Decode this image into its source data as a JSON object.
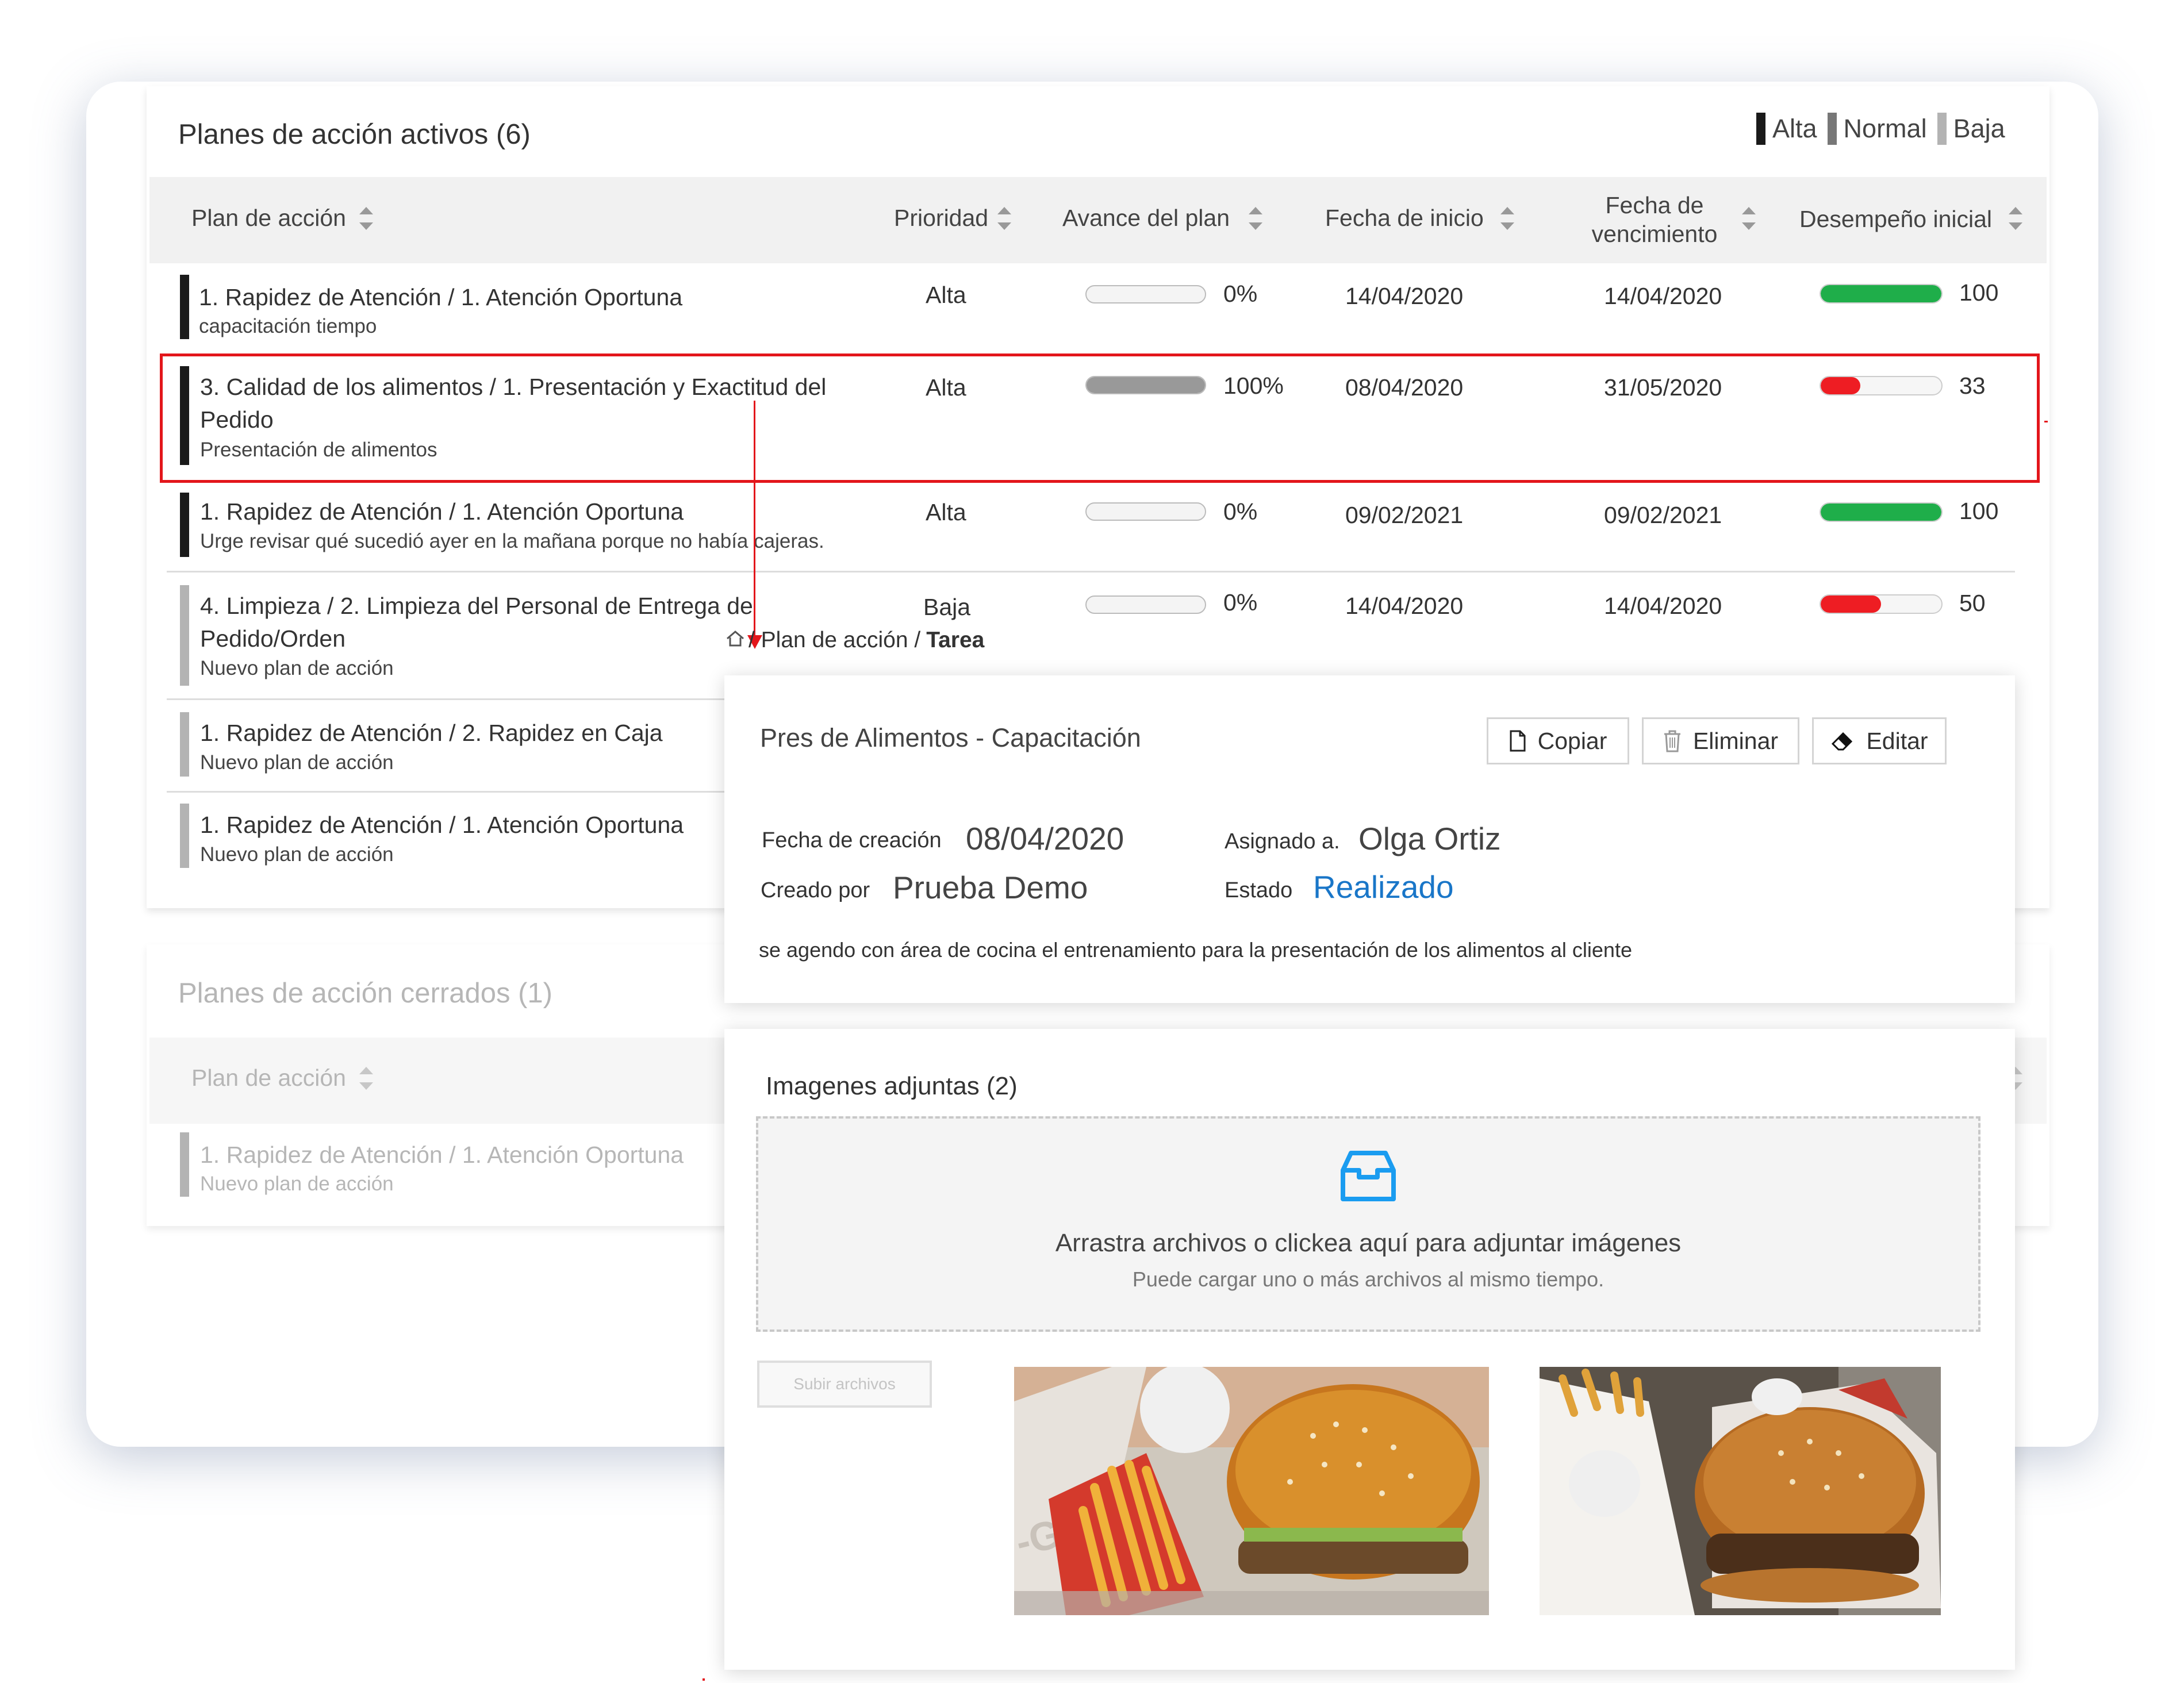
{
  "legend": [
    {
      "label": "Alta",
      "color": "#1a1a1a"
    },
    {
      "label": "Normal",
      "color": "#777777"
    },
    {
      "label": "Baja",
      "color": "#b3b3b3"
    }
  ],
  "active": {
    "title": "Planes de acción activos (6)",
    "columns": {
      "plan": "Plan de acción",
      "prioridad": "Prioridad",
      "avance": "Avance del plan",
      "inicio": "Fecha de inicio",
      "venc_1": "Fecha de",
      "venc_2": "vencimiento",
      "desempeno": "Desempeño inicial"
    },
    "rows": [
      {
        "title_1": "1. Rapidez de Atención / 1. Atención Oportuna",
        "title_2": "",
        "subtitle": "capacitación tiempo",
        "priority": "Alta",
        "progress": 0,
        "progress_label": "0%",
        "start": "14/04/2020",
        "due": "14/04/2020",
        "performance": 100,
        "performance_label": "100",
        "perf_color": "#1fae4a"
      },
      {
        "title_1": "3. Calidad de los alimentos / 1. Presentación y Exactitud del",
        "title_2": "Pedido",
        "subtitle": "Presentación de alimentos",
        "priority": "Alta",
        "progress": 100,
        "progress_label": "100%",
        "start": "08/04/2020",
        "due": "31/05/2020",
        "performance": 33,
        "performance_label": "33",
        "perf_color": "#ee1d23"
      },
      {
        "title_1": "1. Rapidez de Atención / 1. Atención Oportuna",
        "title_2": "",
        "subtitle": "Urge revisar qué sucedió ayer en la mañana porque no había cajeras.",
        "priority": "Alta",
        "progress": 0,
        "progress_label": "0%",
        "start": "09/02/2021",
        "due": "09/02/2021",
        "performance": 100,
        "performance_label": "100",
        "perf_color": "#1fae4a"
      },
      {
        "title_1": "4. Limpieza / 2. Limpieza del Personal de Entrega de",
        "title_2": "Pedido/Orden",
        "subtitle": "Nuevo plan de acción",
        "priority": "Baja",
        "progress": 0,
        "progress_label": "0%",
        "start": "14/04/2020",
        "due": "14/04/2020",
        "performance": 50,
        "performance_label": "50",
        "perf_color": "#ee1d23"
      },
      {
        "title_1": "1. Rapidez de Atención / 2. Rapidez en Caja",
        "title_2": "",
        "subtitle": "Nuevo plan de acción"
      },
      {
        "title_1": "1. Rapidez de Atención / 1. Atención Oportuna",
        "title_2": "",
        "subtitle": "Nuevo plan de acción"
      }
    ]
  },
  "closed": {
    "title": "Planes de acción cerrados (1)",
    "column_plan": "Plan de acción",
    "row": {
      "title_1": "1. Rapidez de Atención / 1. Atención Oportuna",
      "subtitle": "Nuevo plan de acción"
    }
  },
  "breadcrumb": {
    "sep1": "/ Plan de acción /",
    "current": "Tarea"
  },
  "detail": {
    "title": "Pres de Alimentos - Capacitación",
    "buttons": {
      "copy": "Copiar",
      "delete": "Eliminar",
      "edit": "Editar"
    },
    "fecha_label": "Fecha de creación",
    "fecha_value": "08/04/2020",
    "asignado_label": "Asignado a.",
    "asignado_value": "Olga Ortiz",
    "creado_label": "Creado por",
    "creado_value": "Prueba Demo",
    "estado_label": "Estado",
    "estado_value": "Realizado",
    "estado_color": "#1976c8",
    "description": "se agendo con área de cocina el entrenamiento para la presentación de los alimentos al cliente"
  },
  "attachments": {
    "title": "Imagenes adjuntas (2)",
    "drop_main": "Arrastra archivos o clickea aquí para adjuntar imágenes",
    "drop_sub": "Puede cargar uno o más archivos al mismo tiempo.",
    "upload_label": "Subir archivos",
    "photos": [
      "hamburguesa-y-papas-1",
      "hamburguesa-y-papas-2"
    ]
  }
}
